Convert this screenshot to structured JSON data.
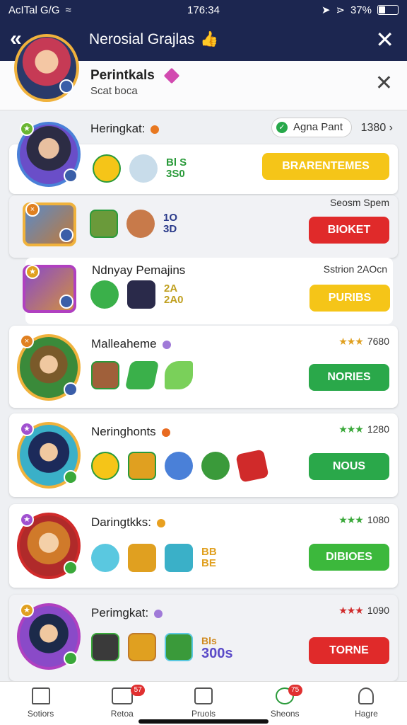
{
  "status_bar": {
    "carrier": "AcITal G/G",
    "time": "176:34",
    "battery": "37%"
  },
  "header": {
    "title": "Nerosial Grajlas",
    "back_icon": "back-chevron-icon",
    "close_icon": "close-icon"
  },
  "profile": {
    "name": "Perintkals",
    "subtitle": "Scat boca"
  },
  "cards": [
    {
      "name": "Heringkat:",
      "pill": "Agna Pant",
      "meta": "1380",
      "button": "BRARENTEMES",
      "button_color": "#f5c518",
      "tile_text": "Bl S\n3S0"
    },
    {
      "name": "",
      "meta": "Seosm Spem",
      "button": "BIOKET",
      "button_color": "#e02a2a",
      "tile_text": "1O\n3D"
    },
    {
      "name": "Ndnyay Pemajins",
      "meta": "Sstrion 2AOcn",
      "button": "PURIBS",
      "button_color": "#f5c518",
      "tile_text": "2A\n2A0"
    },
    {
      "name": "Malleaheme",
      "meta": "7680",
      "button": "NORIES",
      "button_color": "#2aa84a"
    },
    {
      "name": "Neringhonts",
      "meta": "1280",
      "button": "NOUS",
      "button_color": "#2aa84a"
    },
    {
      "name": "Daringtkks:",
      "meta": "1080",
      "button": "DIBIOES",
      "button_color": "#3cb83c",
      "tile_text": "BB\nBE"
    },
    {
      "name": "Perimgkat:",
      "meta": "1090",
      "button": "TORNE",
      "button_color": "#e02a2a",
      "score_top": "Bls",
      "score_main": "300s"
    }
  ],
  "nav": [
    {
      "label": "Sotiors",
      "icon": "home-icon"
    },
    {
      "label": "Retoa",
      "icon": "inbox-icon",
      "badge": "57"
    },
    {
      "label": "Pruols",
      "icon": "card-icon"
    },
    {
      "label": "Sheons",
      "icon": "leaf-icon",
      "badge": "75"
    },
    {
      "label": "Hagre",
      "icon": "person-icon"
    }
  ]
}
